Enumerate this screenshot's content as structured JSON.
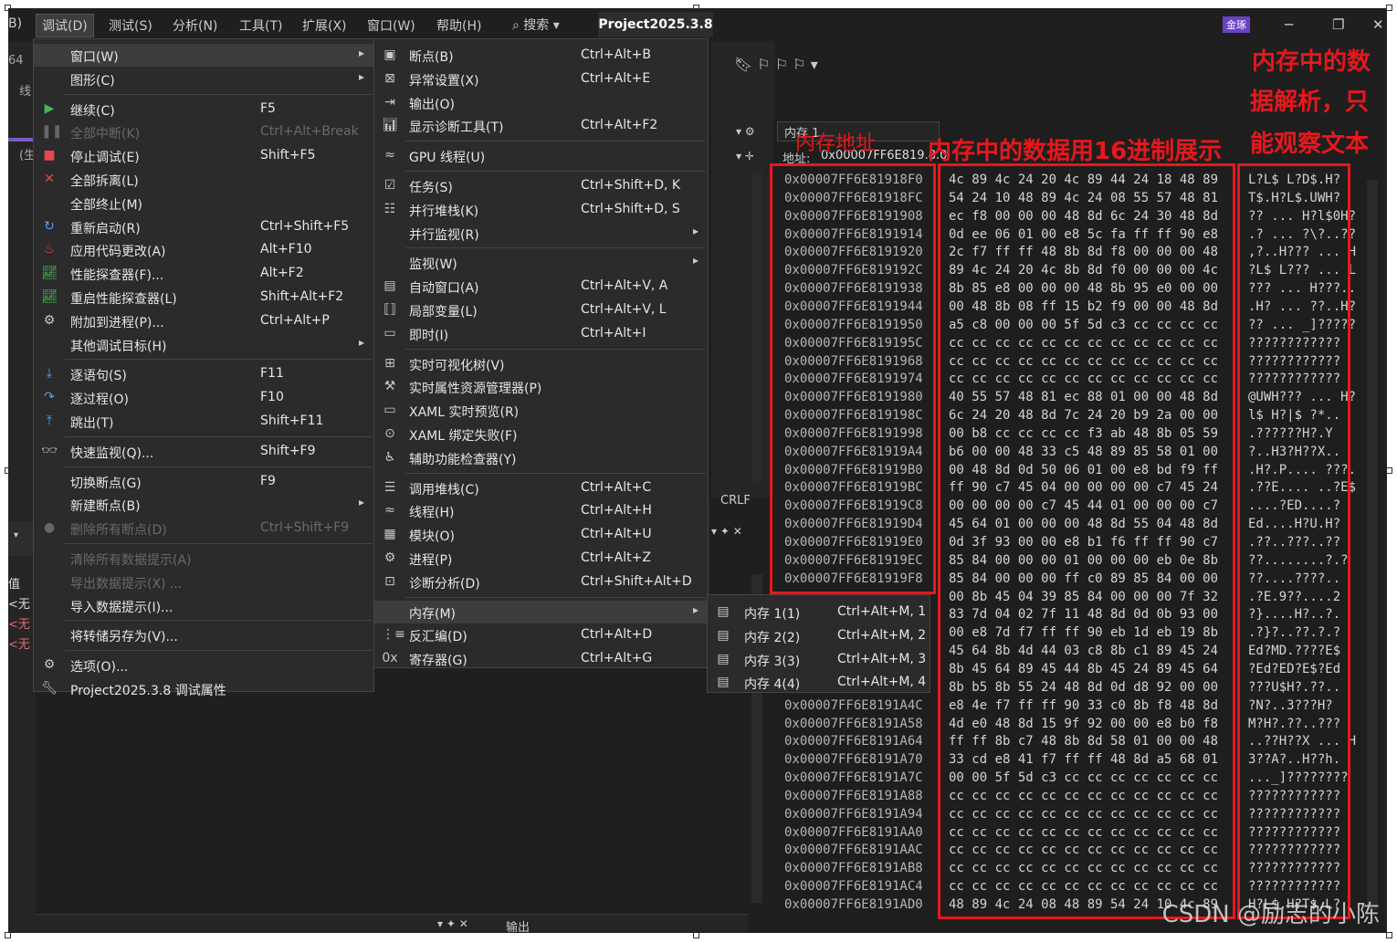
{
  "menubar": {
    "items": [
      "B)",
      "调试(D)",
      "测试(S)",
      "分析(N)",
      "工具(T)",
      "扩展(X)",
      "窗口(W)",
      "帮助(H)"
    ],
    "search": "搜索",
    "project": "Project2025.3.8",
    "badge": "金琢"
  },
  "left_bits": [
    "64",
    "线",
    "(生",
    "值",
    "<无",
    "<无",
    "<无"
  ],
  "debug_menu": [
    {
      "label": "窗口(W)",
      "shortcut": "",
      "icon": "",
      "arrow": true,
      "highlight": true
    },
    {
      "label": "图形(C)",
      "shortcut": "",
      "icon": "",
      "arrow": true
    },
    {
      "sep": true
    },
    {
      "label": "继续(C)",
      "shortcut": "F5",
      "icon": "play-icon",
      "color": "#3fb950"
    },
    {
      "label": "全部中断(K)",
      "shortcut": "Ctrl+Alt+Break",
      "icon": "pause-icon",
      "disabled": true
    },
    {
      "label": "停止调试(E)",
      "shortcut": "Shift+F5",
      "icon": "stop-icon",
      "color": "#e5484d"
    },
    {
      "label": "全部拆离(L)",
      "shortcut": "",
      "icon": "close-icon",
      "color": "#e5484d"
    },
    {
      "label": "全部终止(M)",
      "shortcut": "",
      "icon": ""
    },
    {
      "label": "重新启动(R)",
      "shortcut": "Ctrl+Shift+F5",
      "icon": "restart-icon",
      "color": "#4aa3ff"
    },
    {
      "label": "应用代码更改(A)",
      "shortcut": "Alt+F10",
      "icon": "flame-icon",
      "color": "#e5484d"
    },
    {
      "label": "性能探查器(F)...",
      "shortcut": "Alt+F2",
      "icon": "chart-icon",
      "color": "#3fb950"
    },
    {
      "label": "重启性能探查器(L)",
      "shortcut": "Shift+Alt+F2",
      "icon": "chart-icon",
      "color": "#3fb950"
    },
    {
      "label": "附加到进程(P)...",
      "shortcut": "Ctrl+Alt+P",
      "icon": "gears-icon"
    },
    {
      "label": "其他调试目标(H)",
      "shortcut": "",
      "icon": "",
      "arrow": true
    },
    {
      "sep": true
    },
    {
      "label": "逐语句(S)",
      "shortcut": "F11",
      "icon": "step-into-icon",
      "color": "#4aa3ff"
    },
    {
      "label": "逐过程(O)",
      "shortcut": "F10",
      "icon": "step-over-icon",
      "color": "#4aa3ff"
    },
    {
      "label": "跳出(T)",
      "shortcut": "Shift+F11",
      "icon": "step-out-icon",
      "color": "#4aa3ff"
    },
    {
      "sep": true
    },
    {
      "label": "快速监视(Q)...",
      "shortcut": "Shift+F9",
      "icon": "glasses-icon"
    },
    {
      "sep": true
    },
    {
      "label": "切换断点(G)",
      "shortcut": "F9",
      "icon": ""
    },
    {
      "label": "新建断点(B)",
      "shortcut": "",
      "icon": "",
      "arrow": true
    },
    {
      "label": "删除所有断点(D)",
      "shortcut": "Ctrl+Shift+F9",
      "icon": "breakpoints-icon",
      "disabled": true
    },
    {
      "sep": true
    },
    {
      "label": "清除所有数据提示(A)",
      "shortcut": "",
      "icon": "",
      "disabled": true
    },
    {
      "label": "导出数据提示(X) ...",
      "shortcut": "",
      "icon": "",
      "disabled": true
    },
    {
      "label": "导入数据提示(I)...",
      "shortcut": "",
      "icon": ""
    },
    {
      "sep": true
    },
    {
      "label": "将转储另存为(V)...",
      "shortcut": "",
      "icon": ""
    },
    {
      "sep": true
    },
    {
      "label": "选项(O)...",
      "shortcut": "",
      "icon": "gear-icon"
    },
    {
      "label": "Project2025.3.8 调试属性",
      "shortcut": "",
      "icon": "wrench-icon"
    }
  ],
  "window_menu": [
    {
      "label": "断点(B)",
      "shortcut": "Ctrl+Alt+B",
      "icon": "breakpoint-window-icon"
    },
    {
      "label": "异常设置(X)",
      "shortcut": "Ctrl+Alt+E",
      "icon": "exception-icon"
    },
    {
      "label": "输出(O)",
      "shortcut": "",
      "icon": "output-icon"
    },
    {
      "label": "显示诊断工具(T)",
      "shortcut": "Ctrl+Alt+F2",
      "icon": "diagnostics-icon"
    },
    {
      "sep": true
    },
    {
      "label": "GPU 线程(U)",
      "shortcut": "",
      "icon": "gpu-threads-icon"
    },
    {
      "sep": true
    },
    {
      "label": "任务(S)",
      "shortcut": "Ctrl+Shift+D, K",
      "icon": "tasks-icon"
    },
    {
      "label": "并行堆栈(K)",
      "shortcut": "Ctrl+Shift+D, S",
      "icon": "parallel-stacks-icon"
    },
    {
      "label": "并行监视(R)",
      "shortcut": "",
      "icon": "",
      "arrow": true
    },
    {
      "sep": true
    },
    {
      "label": "监视(W)",
      "shortcut": "",
      "icon": "",
      "arrow": true
    },
    {
      "label": "自动窗口(A)",
      "shortcut": "Ctrl+Alt+V, A",
      "icon": "autos-icon"
    },
    {
      "label": "局部变量(L)",
      "shortcut": "Ctrl+Alt+V, L",
      "icon": "locals-icon"
    },
    {
      "label": "即时(I)",
      "shortcut": "Ctrl+Alt+I",
      "icon": "immediate-icon"
    },
    {
      "sep": true
    },
    {
      "label": "实时可视化树(V)",
      "shortcut": "",
      "icon": "visual-tree-icon"
    },
    {
      "label": "实时属性资源管理器(P)",
      "shortcut": "",
      "icon": "property-explorer-icon"
    },
    {
      "label": "XAML 实时预览(R)",
      "shortcut": "",
      "icon": "xaml-preview-icon"
    },
    {
      "label": "XAML 绑定失败(F)",
      "shortcut": "",
      "icon": "xaml-binding-icon"
    },
    {
      "label": "辅助功能检查器(Y)",
      "shortcut": "",
      "icon": "accessibility-icon"
    },
    {
      "sep": true
    },
    {
      "label": "调用堆栈(C)",
      "shortcut": "Ctrl+Alt+C",
      "icon": "call-stack-icon"
    },
    {
      "label": "线程(H)",
      "shortcut": "Ctrl+Alt+H",
      "icon": "threads-icon"
    },
    {
      "label": "模块(O)",
      "shortcut": "Ctrl+Alt+U",
      "icon": "modules-icon"
    },
    {
      "label": "进程(P)",
      "shortcut": "Ctrl+Alt+Z",
      "icon": "processes-icon"
    },
    {
      "label": "诊断分析(D)",
      "shortcut": "Ctrl+Shift+Alt+D",
      "icon": "diagnostic-analysis-icon"
    },
    {
      "sep": true
    },
    {
      "label": "内存(M)",
      "shortcut": "",
      "icon": "",
      "arrow": true,
      "highlight": true
    },
    {
      "label": "反汇编(D)",
      "shortcut": "Ctrl+Alt+D",
      "icon": "disassembly-icon"
    },
    {
      "label": "寄存器(G)",
      "shortcut": "Ctrl+Alt+G",
      "icon": "registers-icon"
    }
  ],
  "memory_menu": [
    {
      "label": "内存 1(1)",
      "shortcut": "Ctrl+Alt+M, 1",
      "icon": "memory-icon"
    },
    {
      "label": "内存 2(2)",
      "shortcut": "Ctrl+Alt+M, 2",
      "icon": "memory-icon"
    },
    {
      "label": "内存 3(3)",
      "shortcut": "Ctrl+Alt+M, 3",
      "icon": "memory-icon"
    },
    {
      "label": "内存 4(4)",
      "shortcut": "Ctrl+Alt+M, 4",
      "icon": "memory-icon"
    }
  ],
  "memory_window": {
    "title": "内存 1",
    "address_label": "地址:",
    "address_value": "0x00007FF6E819.8.0",
    "crlf": "CRLF",
    "rows": [
      [
        "0x00007FF6E81918F0",
        "4c 89 4c 24 20 4c 89 44 24 18 48 89",
        "L?L$ L?D$.H?"
      ],
      [
        "0x00007FF6E81918FC",
        "54 24 10 48 89 4c 24 08 55 57 48 81",
        "T$.H?L$.UWH?"
      ],
      [
        "0x00007FF6E8191908",
        "ec f8 00 00 00 48 8d 6c 24 30 48 8d",
        "?? ... H?l$0H?"
      ],
      [
        "0x00007FF6E8191914",
        "0d ee 06 01 00 e8 5c fa ff ff 90 e8",
        ".? ... ?\\?..??"
      ],
      [
        "0x00007FF6E8191920",
        "2c f7 ff ff 48 8b 8d f8 00 00 00 48",
        ",?..H??? ... H"
      ],
      [
        "0x00007FF6E819192C",
        "89 4c 24 20 4c 8b 8d f0 00 00 00 4c",
        "?L$ L??? ... L"
      ],
      [
        "0x00007FF6E8191938",
        "8b 85 e8 00 00 00 48 8b 95 e0 00 00",
        "??? ... H???.."
      ],
      [
        "0x00007FF6E8191944",
        "00 48 8b 08 ff 15 b2 f9 00 00 48 8d",
        ".H? ... ??..H?"
      ],
      [
        "0x00007FF6E8191950",
        "a5 c8 00 00 00 5f 5d c3 cc cc cc cc",
        "?? ... _]?????"
      ],
      [
        "0x00007FF6E819195C",
        "cc cc cc cc cc cc cc cc cc cc cc cc",
        "????????????"
      ],
      [
        "0x00007FF6E8191968",
        "cc cc cc cc cc cc cc cc cc cc cc cc",
        "????????????"
      ],
      [
        "0x00007FF6E8191974",
        "cc cc cc cc cc cc cc cc cc cc cc cc",
        "????????????"
      ],
      [
        "0x00007FF6E8191980",
        "40 55 57 48 81 ec 88 01 00 00 48 8d",
        "@UWH??? ... H?"
      ],
      [
        "0x00007FF6E819198C",
        "6c 24 20 48 8d 7c 24 20 b9 2a 00 00",
        "l$ H?|$ ?*.."
      ],
      [
        "0x00007FF6E8191998",
        "00 b8 cc cc cc cc f3 ab 48 8b 05 59",
        ".??????H?.Y"
      ],
      [
        "0x00007FF6E81919A4",
        "b6 00 00 48 33 c5 48 89 85 58 01 00",
        "?..H3?H??X.."
      ],
      [
        "0x00007FF6E81919B0",
        "00 48 8d 0d 50 06 01 00 e8 bd f9 ff",
        ".H?.P.... ???."
      ],
      [
        "0x00007FF6E81919BC",
        "ff 90 c7 45 04 00 00 00 00 c7 45 24",
        ".??E.... ..?E$"
      ],
      [
        "0x00007FF6E81919C8",
        "00 00 00 00 c7 45 44 01 00 00 00 c7",
        "....?ED....?"
      ],
      [
        "0x00007FF6E81919D4",
        "45 64 01 00 00 00 48 8d 55 04 48 8d",
        "Ed....H?U.H?"
      ],
      [
        "0x00007FF6E81919E0",
        "0d 3f 93 00 00 e8 b1 f6 ff ff 90 c7",
        ".??..???..??"
      ],
      [
        "0x00007FF6E81919EC",
        "85 84 00 00 00 01 00 00 00 eb 0e 8b",
        "??........?.?"
      ],
      [
        "0x00007FF6E81919F8",
        "85 84 00 00 00 ff c0 89 85 84 00 00",
        "??....????.."
      ],
      [
        "",
        "00 8b 45 04 39 85 84 00 00 00 7f 32",
        ".?E.9??....2"
      ],
      [
        "",
        "83 7d 04 02 7f 11 48 8d 0d 0b 93 00",
        "?}....H?..?."
      ],
      [
        "",
        "00 e8 7d f7 ff ff 90 eb 1d eb 19 8b",
        ".?}?..??.?.?"
      ],
      [
        "",
        "45 64 8b 4d 44 03 c8 8b c1 89 45 24",
        "Ed?MD.????E$"
      ],
      [
        "",
        "8b 45 64 89 45 44 8b 45 24 89 45 64",
        "?Ed?ED?E$?Ed"
      ],
      [
        "",
        "8b b5 8b 55 24 48 8d 0d d8 92 00 00",
        "???U$H?.??.."
      ],
      [
        "0x00007FF6E8191A4C",
        "e8 4e f7 ff ff 90 33 c0 8b f8 48 8d",
        "?N?..3???H?"
      ],
      [
        "0x00007FF6E8191A58",
        "4d e0 48 8d 15 9f 92 00 00 e8 b0 f8",
        "M?H?.??..???"
      ],
      [
        "0x00007FF6E8191A64",
        "ff ff 8b c7 48 8b 8d 58 01 00 00 48",
        "..??H??X ... H"
      ],
      [
        "0x00007FF6E8191A70",
        "33 cd e8 41 f7 ff ff 48 8d a5 68 01",
        "3??A?..H??h."
      ],
      [
        "0x00007FF6E8191A7C",
        "00 00 5f 5d c3 cc cc cc cc cc cc cc",
        "..._]????????"
      ],
      [
        "0x00007FF6E8191A88",
        "cc cc cc cc cc cc cc cc cc cc cc cc",
        "????????????"
      ],
      [
        "0x00007FF6E8191A94",
        "cc cc cc cc cc cc cc cc cc cc cc cc",
        "????????????"
      ],
      [
        "0x00007FF6E8191AA0",
        "cc cc cc cc cc cc cc cc cc cc cc cc",
        "????????????"
      ],
      [
        "0x00007FF6E8191AAC",
        "cc cc cc cc cc cc cc cc cc cc cc cc",
        "????????????"
      ],
      [
        "0x00007FF6E8191AB8",
        "cc cc cc cc cc cc cc cc cc cc cc cc",
        "????????????"
      ],
      [
        "0x00007FF6E8191AC4",
        "cc cc cc cc cc cc cc cc cc cc cc cc",
        "????????????"
      ],
      [
        "0x00007FF6E8191AD0",
        "48 89 4c 24 08 48 89 54 24 10 4c 89",
        "H?L$.H?T$.L?"
      ]
    ]
  },
  "annotations": {
    "address": "内存地址",
    "hex": "内存中的数据用16进制展示",
    "text_line1": "内存中的数",
    "text_line2": "据解析，只",
    "text_line3": "能观察文本"
  },
  "bottom_bar": {
    "output": "输出"
  },
  "watermark": "CSDN @励志的小陈",
  "colors": {
    "annotation": "#e8171c",
    "menu_bg": "#2b2b2b",
    "highlight": "#3d3d3d"
  }
}
